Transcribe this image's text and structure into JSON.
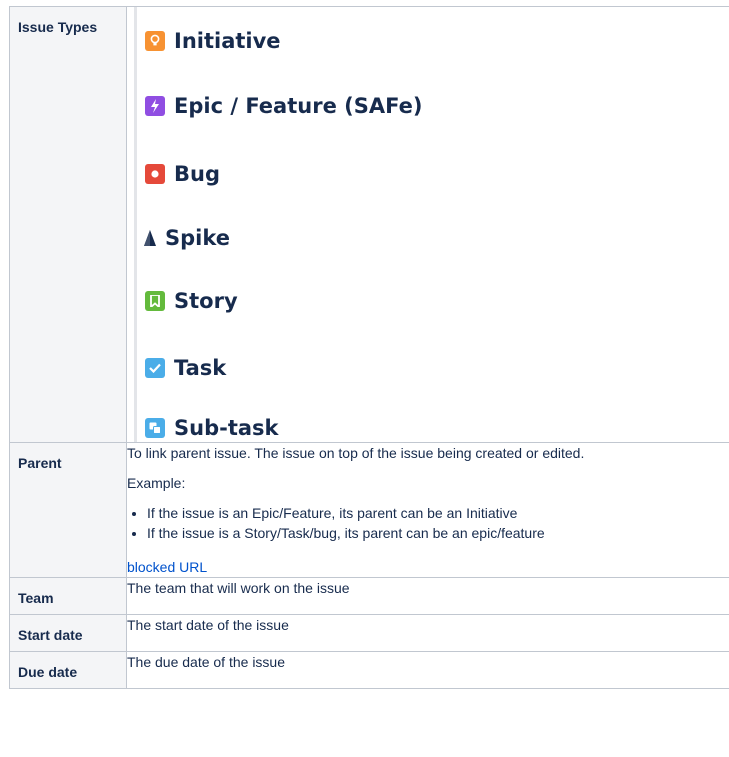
{
  "rows": {
    "issue_types": {
      "header": "Issue Types",
      "types": [
        {
          "label": "Initiative",
          "icon": "lightbulb-icon",
          "color": "#f79232"
        },
        {
          "label": "Epic / Feature (SAFe)",
          "icon": "lightning-icon",
          "color": "#904ee2"
        },
        {
          "label": "Bug",
          "icon": "bug-dot-icon",
          "color": "#e5493a"
        },
        {
          "label": "Spike",
          "icon": "spike-icon",
          "color": "#172b4d"
        },
        {
          "label": "Story",
          "icon": "bookmark-icon",
          "color": "#63ba3c"
        },
        {
          "label": "Task",
          "icon": "checkbox-icon",
          "color": "#4bade8"
        },
        {
          "label": "Sub-task",
          "icon": "subtask-icon",
          "color": "#4bade8"
        }
      ]
    },
    "parent": {
      "header": "Parent",
      "description": "To link parent issue. The issue on top of the issue being created or edited.",
      "example_label": "Example:",
      "bullets": [
        "If the issue is an Epic/Feature, its parent can be an Initiative",
        "If the issue is a Story/Task/bug, its parent can be an epic/feature"
      ],
      "link_text": "blocked URL"
    },
    "team": {
      "header": "Team",
      "description": "The team that will work on the issue"
    },
    "start_date": {
      "header": "Start date",
      "description": "The start date of the issue"
    },
    "due_date": {
      "header": "Due date",
      "description": "The due date of the issue"
    }
  }
}
